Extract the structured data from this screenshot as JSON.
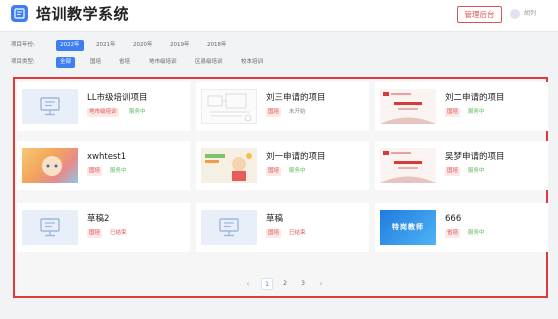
{
  "header": {
    "title": "培训教学系统",
    "admin_button": "管理后台",
    "username": "胡列",
    "colors": {
      "accent": "#3d7ef0",
      "danger": "#e05252"
    }
  },
  "filters": {
    "year_label": "项目年份:",
    "years": [
      "2022年",
      "2021年",
      "2020年",
      "2019年",
      "2018年"
    ],
    "selected_year": "2022年",
    "type_label": "项目类型:",
    "types": [
      "全部",
      "国培",
      "省培",
      "地市级培训",
      "区县级培训",
      "校本培训"
    ],
    "selected_type": "全部"
  },
  "projects": [
    {
      "title": "LL市级培训项目",
      "type": "地市级培训",
      "status": "服务中",
      "thumb": "placeholder-icon"
    },
    {
      "title": "刘三申请的项目",
      "type": "国培",
      "status": "未开始",
      "thumb": "sketch-image"
    },
    {
      "title": "刘二申请的项目",
      "type": "国培",
      "status": "服务中",
      "thumb": "red-slide-image"
    },
    {
      "title": "xwhtest1",
      "type": "国培",
      "status": "服务中",
      "thumb": "cartoon-image"
    },
    {
      "title": "刘一申请的项目",
      "type": "国培",
      "status": "服务中",
      "thumb": "kids-image"
    },
    {
      "title": "吴梦申请的项目",
      "type": "国培",
      "status": "服务中",
      "thumb": "red-slide-image"
    },
    {
      "title": "草稿2",
      "type": "国培",
      "status": "已结束",
      "thumb": "placeholder-icon"
    },
    {
      "title": "草稿",
      "type": "国培",
      "status": "已结束",
      "thumb": "placeholder-icon"
    },
    {
      "title": "666",
      "type": "省培",
      "status": "服务中",
      "thumb": "blue-banner-image",
      "thumb_text": "特岗教师"
    }
  ],
  "pagination": {
    "prev": "‹",
    "pages": [
      "1",
      "2",
      "3"
    ],
    "current": "1",
    "next": "›"
  }
}
